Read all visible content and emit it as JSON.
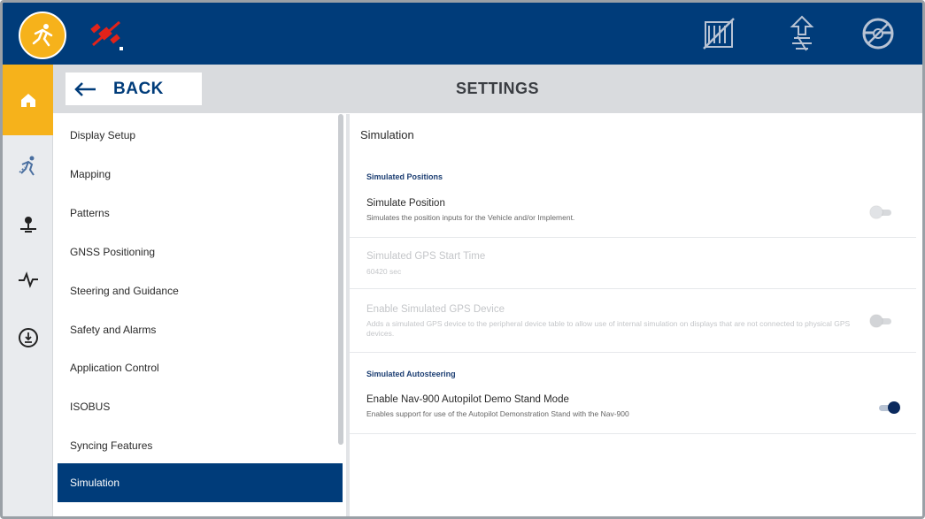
{
  "header": {
    "back_label": "BACK",
    "title": "SETTINGS"
  },
  "menu": {
    "items": [
      {
        "label": "Display Setup"
      },
      {
        "label": "Mapping"
      },
      {
        "label": "Patterns"
      },
      {
        "label": "GNSS Positioning"
      },
      {
        "label": "Steering and Guidance"
      },
      {
        "label": "Safety and Alarms"
      },
      {
        "label": "Application Control"
      },
      {
        "label": "ISOBUS"
      },
      {
        "label": "Syncing Features"
      },
      {
        "label": "Simulation"
      }
    ],
    "active": "Simulation"
  },
  "detail": {
    "title": "Simulation",
    "section1": "Simulated Positions",
    "rows": [
      {
        "title": "Simulate Position",
        "subtitle": "Simulates the position inputs for the Vehicle and/or Implement.",
        "toggle": "off",
        "enabled": true
      },
      {
        "title": "Simulated GPS Start Time",
        "subtitle": "60420 sec",
        "enabled": false
      },
      {
        "title": "Enable Simulated GPS Device",
        "subtitle": "Adds a simulated GPS device to the peripheral device table to allow use of internal simulation on displays that are not connected to physical GPS devices.",
        "toggle": "off",
        "enabled": false
      },
      {
        "title": "Enable Nav-900 Autopilot Demo Stand Mode",
        "subtitle": "Enables support for use of the Autopilot Demonstration Stand with the Nav-900",
        "toggle": "on",
        "enabled": true
      }
    ],
    "section2": "Simulated Autosteering"
  },
  "icons": {
    "logo": "running-figure-icon",
    "satellite": "satellite-off-icon",
    "top_right": [
      "field-map-off-icon",
      "implement-guidance-icon",
      "steering-wheel-off-icon"
    ],
    "rail": [
      "home-icon",
      "running-figure-icon",
      "location-pin-icon",
      "pulse-icon",
      "guidance-circle-icon"
    ]
  },
  "colors": {
    "primary": "#003c7a",
    "accent": "#f6b21b",
    "disabled_text": "#c4c6c9",
    "toggle_on": "#0b2a5e"
  }
}
